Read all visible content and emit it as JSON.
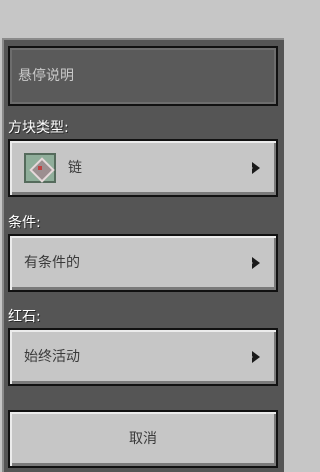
{
  "tooltip_field": {
    "placeholder": "悬停说明"
  },
  "block_type": {
    "label": "方块类型:",
    "value": "链",
    "icon": "chain-command-block-icon"
  },
  "condition": {
    "label": "条件:",
    "value": "有条件的"
  },
  "redstone": {
    "label": "红石:",
    "value": "始终活动"
  },
  "cancel_label": "取消",
  "colors": {
    "panel": "#555555",
    "button": "#c6c6c6",
    "label_text": "#ffffff",
    "button_text": "#3a3a3a"
  }
}
